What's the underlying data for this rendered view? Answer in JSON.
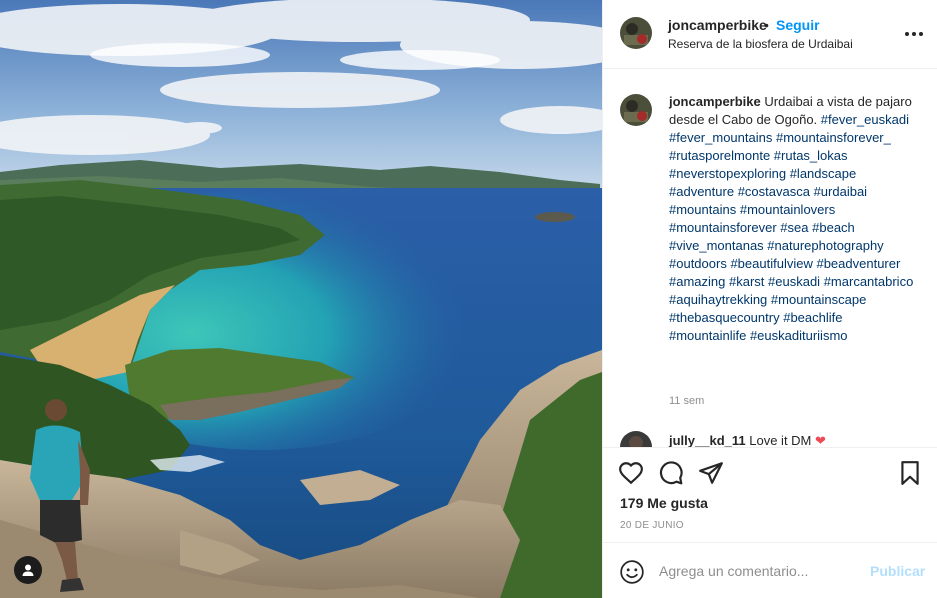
{
  "post": {
    "image_alt": "",
    "tag_icon": "user-icon"
  },
  "header": {
    "username": "joncamperbike",
    "separator": "•",
    "follow_label": "Seguir",
    "location": "Reserva de la biosfera de Urdaibai",
    "more_icon": "more-options-icon"
  },
  "caption": {
    "username": "joncamperbike",
    "text": "Urdaibai a vista de pajaro desde el Cabo de Ogoño.",
    "hashtags": [
      "#fever_euskadi",
      "#fever_mountains",
      "#mountainsforever_",
      "#rutasporelmonte",
      "#rutas_lokas",
      "#neverstopexploring",
      "#landscape",
      "#adventure",
      "#costavasca",
      "#urdaibai",
      "#mountains",
      "#mountainlovers",
      "#mountainsforever",
      "#sea",
      "#beach",
      "#vive_montanas",
      "#naturephotography",
      "#outdoors",
      "#beautifulview",
      "#beadventurer",
      "#amazing",
      "#karst",
      "#euskadi",
      "#marcantabrico",
      "#aquihaytrekking",
      "#mountainscape",
      "#thebasquecountry",
      "#beachlife",
      "#mountainlife",
      "#euskadituriismo"
    ],
    "time_ago": "11 sem"
  },
  "reply": {
    "username": "jully__kd_11",
    "text": "Love it DM",
    "emoji": "❤"
  },
  "actions": {
    "like_icon": "heart-icon",
    "comment_icon": "comment-icon",
    "share_icon": "share-icon",
    "save_icon": "bookmark-icon"
  },
  "likes": "179 Me gusta",
  "date": "20 DE JUNIO",
  "composer": {
    "emoji_icon": "emoji-icon",
    "placeholder": "Agrega un comentario...",
    "publish_label": "Publicar"
  },
  "colors": {
    "link_blue": "#0095f6",
    "hashtag": "#00376b",
    "publish_disabled": "#b2dffc",
    "muted": "#8e8e8e"
  }
}
